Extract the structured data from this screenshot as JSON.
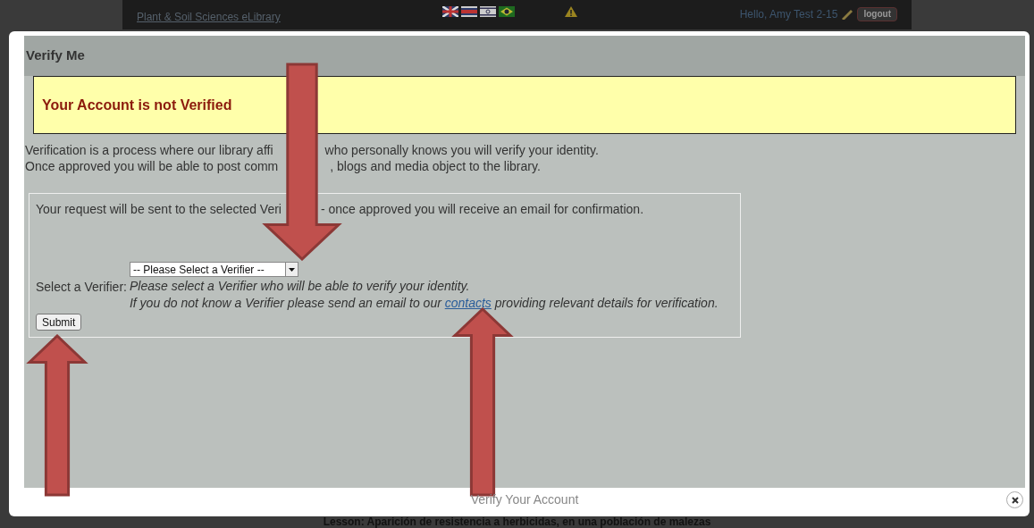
{
  "top_bar": {
    "site_link": "Plant & Soil Sciences eLibrary",
    "greeting": "Hello, Amy Test 2-15",
    "logout": "logout"
  },
  "background": {
    "lesson_title": "Lesson: Aparición de resistencia a herbicidas, en una población de malezas"
  },
  "modal": {
    "heading": "Verify Me",
    "alert": "Your Account is not Verified",
    "intro_lines": [
      [
        "Verification is a process where our library affi",
        "who personally knows you will verify your identity."
      ],
      [
        "Once approved you will be able to post comm",
        ", blogs and media object to the library."
      ]
    ],
    "form": {
      "notice": [
        "Your request will be sent to the selected Veri",
        "- once approved you will receive an email for confirmation."
      ],
      "verifier_label": "Select a Verifier:",
      "verifier_select": "-- Please Select a Verifier --",
      "help_line": "Please select a Verifier who will be able to verify your identity.",
      "contact_line": {
        "before": "If you do not know a Verifier please send an email to our",
        "link": "contacts",
        "after": "providing relevant details for verification."
      },
      "submit": "Submit"
    },
    "caption": "Verify Your Account"
  },
  "annotation_arrows": [
    {
      "kind": "down"
    },
    {
      "kind": "up"
    },
    {
      "kind": "up"
    }
  ]
}
